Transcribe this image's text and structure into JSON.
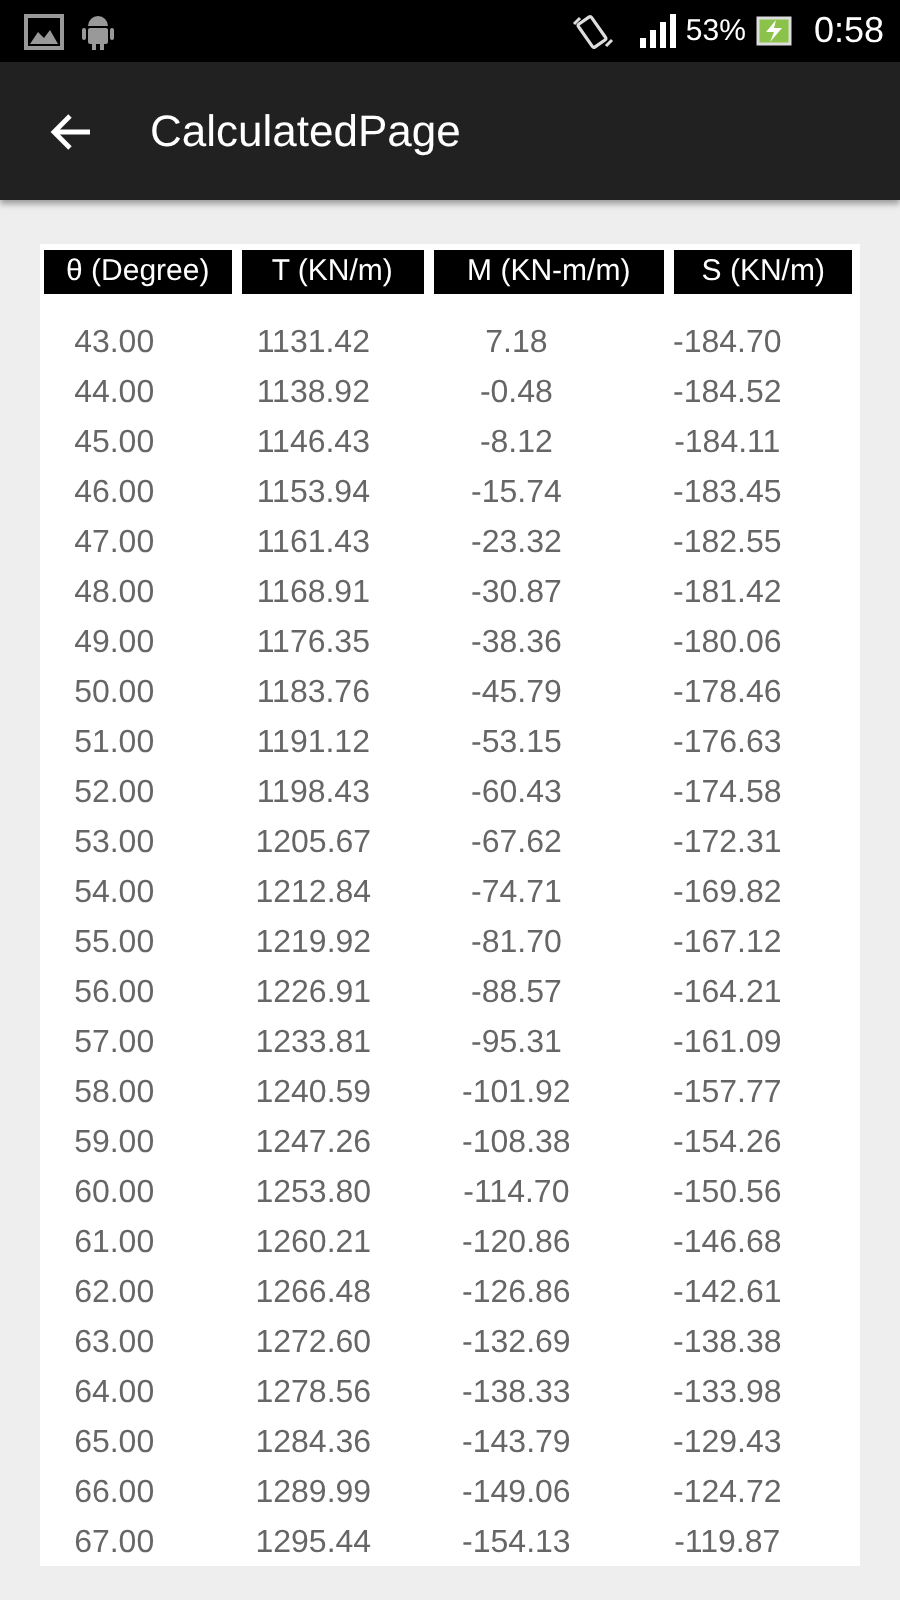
{
  "status_bar": {
    "battery": "53%",
    "time": "0:58"
  },
  "app_bar": {
    "title": "CalculatedPage"
  },
  "table": {
    "columns": [
      "θ (Degree)",
      "T (KN/m)",
      "M (KN-m/m)",
      "S (KN/m)"
    ],
    "rows": [
      [
        "43.00",
        "1131.42",
        "7.18",
        "-184.70"
      ],
      [
        "44.00",
        "1138.92",
        "-0.48",
        "-184.52"
      ],
      [
        "45.00",
        "1146.43",
        "-8.12",
        "-184.11"
      ],
      [
        "46.00",
        "1153.94",
        "-15.74",
        "-183.45"
      ],
      [
        "47.00",
        "1161.43",
        "-23.32",
        "-182.55"
      ],
      [
        "48.00",
        "1168.91",
        "-30.87",
        "-181.42"
      ],
      [
        "49.00",
        "1176.35",
        "-38.36",
        "-180.06"
      ],
      [
        "50.00",
        "1183.76",
        "-45.79",
        "-178.46"
      ],
      [
        "51.00",
        "1191.12",
        "-53.15",
        "-176.63"
      ],
      [
        "52.00",
        "1198.43",
        "-60.43",
        "-174.58"
      ],
      [
        "53.00",
        "1205.67",
        "-67.62",
        "-172.31"
      ],
      [
        "54.00",
        "1212.84",
        "-74.71",
        "-169.82"
      ],
      [
        "55.00",
        "1219.92",
        "-81.70",
        "-167.12"
      ],
      [
        "56.00",
        "1226.91",
        "-88.57",
        "-164.21"
      ],
      [
        "57.00",
        "1233.81",
        "-95.31",
        "-161.09"
      ],
      [
        "58.00",
        "1240.59",
        "-101.92",
        "-157.77"
      ],
      [
        "59.00",
        "1247.26",
        "-108.38",
        "-154.26"
      ],
      [
        "60.00",
        "1253.80",
        "-114.70",
        "-150.56"
      ],
      [
        "61.00",
        "1260.21",
        "-120.86",
        "-146.68"
      ],
      [
        "62.00",
        "1266.48",
        "-126.86",
        "-142.61"
      ],
      [
        "63.00",
        "1272.60",
        "-132.69",
        "-138.38"
      ],
      [
        "64.00",
        "1278.56",
        "-138.33",
        "-133.98"
      ],
      [
        "65.00",
        "1284.36",
        "-143.79",
        "-129.43"
      ],
      [
        "66.00",
        "1289.99",
        "-149.06",
        "-124.72"
      ],
      [
        "67.00",
        "1295.44",
        "-154.13",
        "-119.87"
      ]
    ]
  }
}
